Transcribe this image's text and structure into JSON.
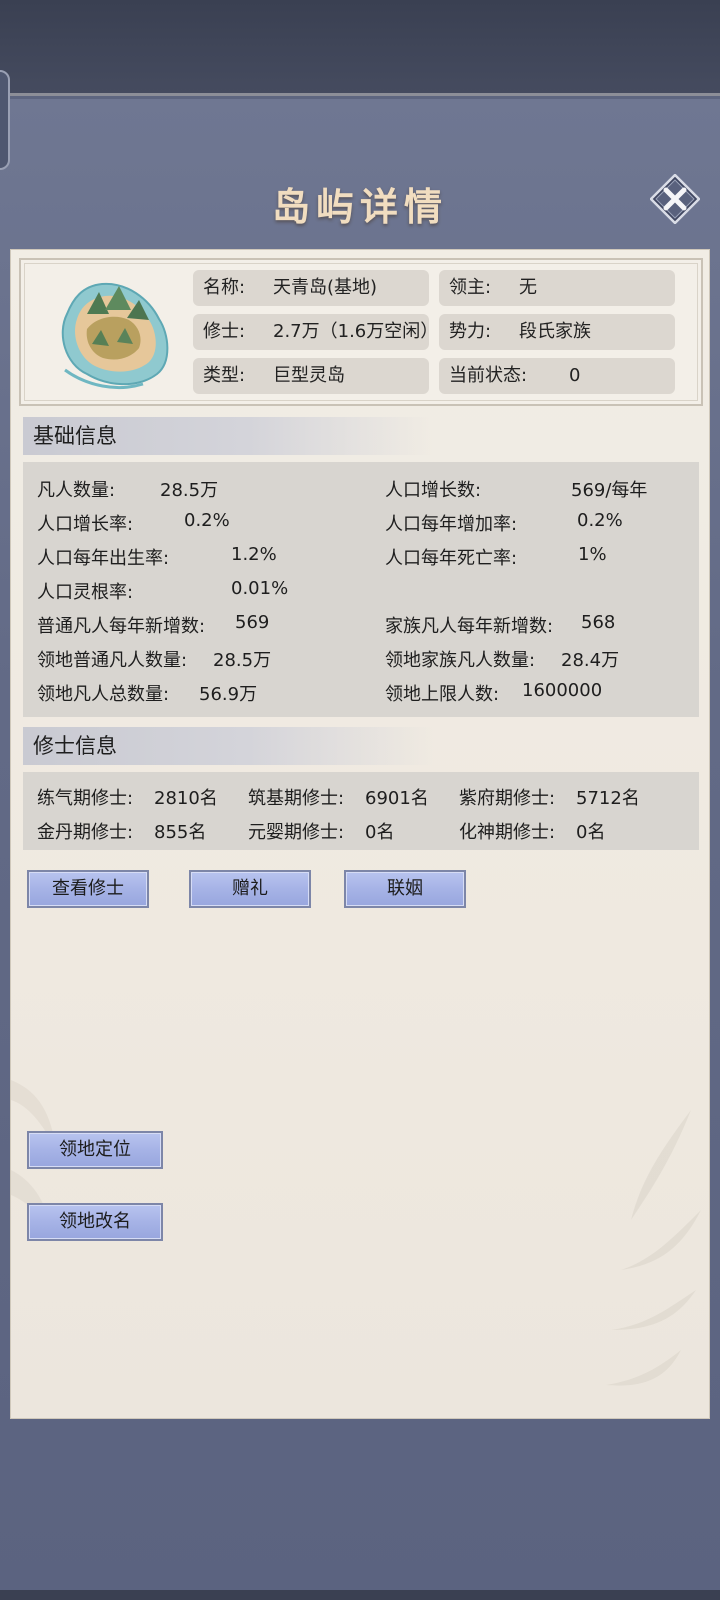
{
  "title": "岛屿详情",
  "header": {
    "name_key": "名称:",
    "name_val": "天青岛(基地)",
    "lord_key": "领主:",
    "lord_val": "无",
    "cultivators_key": "修士:",
    "cultivators_val": "2.7万（1.6万空闲）",
    "faction_key": "势力:",
    "faction_val": "段氏家族",
    "type_key": "类型:",
    "type_val": "巨型灵岛",
    "status_key": "当前状态:",
    "status_val": "0"
  },
  "basic": {
    "title": "基础信息",
    "mortals_key": "凡人数量:",
    "mortals_val": "28.5万",
    "pop_growth_key": "人口增长数:",
    "pop_growth_val": "569/每年",
    "growth_rate_key": "人口增长率:",
    "growth_rate_val": "0.2%",
    "yearly_increase_key": "人口每年增加率:",
    "yearly_increase_val": "0.2%",
    "birth_rate_key": "人口每年出生率:",
    "birth_rate_val": "1.2%",
    "death_rate_key": "人口每年死亡率:",
    "death_rate_val": "1%",
    "spirit_root_key": "人口灵根率:",
    "spirit_root_val": "0.01%",
    "common_new_key": "普通凡人每年新增数:",
    "common_new_val": "569",
    "family_new_key": "家族凡人每年新增数:",
    "family_new_val": "568",
    "territory_common_key": "领地普通凡人数量:",
    "territory_common_val": "28.5万",
    "territory_family_key": "领地家族凡人数量:",
    "territory_family_val": "28.4万",
    "territory_total_key": "领地凡人总数量:",
    "territory_total_val": "56.9万",
    "territory_cap_key": "领地上限人数:",
    "territory_cap_val": "1600000"
  },
  "cultivator": {
    "title": "修士信息",
    "qi_key": "练气期修士:",
    "qi_val": "2810名",
    "foundation_key": "筑基期修士:",
    "foundation_val": "6901名",
    "purple_key": "紫府期修士:",
    "purple_val": "5712名",
    "golden_key": "金丹期修士:",
    "golden_val": "855名",
    "nascent_key": "元婴期修士:",
    "nascent_val": "0名",
    "deity_key": "化神期修士:",
    "deity_val": "0名"
  },
  "buttons": {
    "view": "查看修士",
    "gift": "赠礼",
    "marriage": "联姻",
    "locate": "领地定位",
    "rename": "领地改名"
  },
  "icons": {
    "close": "close-icon",
    "island": "island-map-icon"
  },
  "colors": {
    "title": "#f1ddc0",
    "button": "#a6b3e6",
    "background": "#626a86",
    "card": "#efe9e0"
  }
}
